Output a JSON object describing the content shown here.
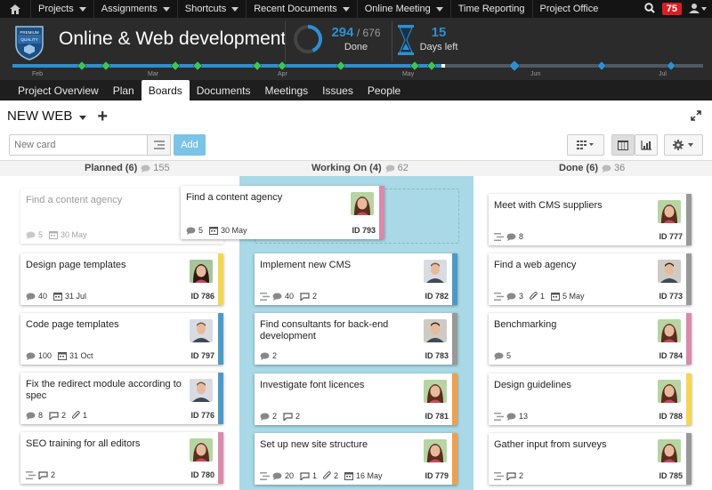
{
  "topnav": {
    "items": [
      "Projects",
      "Assignments",
      "Shortcuts",
      "Recent Documents",
      "Online Meeting",
      "Time Reporting",
      "Project Office"
    ],
    "notifications": "75"
  },
  "header": {
    "badge_text": "PREMIUM QUALITY",
    "title": "Online & Web development",
    "done_value": "294",
    "done_total": "/ 676",
    "done_label": "Done",
    "days_value": "15",
    "days_label": "Days left",
    "done_fraction": 0.435,
    "accent": "#2e8fd0"
  },
  "timeline": {
    "months": [
      "Feb",
      "Mar",
      "Apr",
      "May",
      "Jun",
      "Jul"
    ]
  },
  "tabs": [
    "Project Overview",
    "Plan",
    "Boards",
    "Documents",
    "Meetings",
    "Issues",
    "People"
  ],
  "active_tab": "Boards",
  "board": {
    "name": "NEW WEB",
    "new_card_placeholder": "New card",
    "add_label": "Add"
  },
  "columns": [
    {
      "name": "Planned (6)",
      "comments": "155"
    },
    {
      "name": "Working On (4)",
      "comments": "62"
    },
    {
      "name": "Done (6)",
      "comments": "36"
    }
  ],
  "cards": {
    "ghost": {
      "title": "Find a content agency",
      "comments": "5",
      "date": "30 May"
    },
    "dragging": {
      "title": "Find a content agency",
      "comments": "5",
      "date": "30 May",
      "id": "ID 793",
      "color": "#d98bab"
    },
    "planned": [
      {
        "title": "Design page templates",
        "comments": "40",
        "date": "31 Jul",
        "id": "ID 786",
        "color": "#f5d651"
      },
      {
        "title": "Code page templates",
        "comments": "100",
        "date": "31 Oct",
        "id": "ID 797",
        "color": "#4c99c5"
      },
      {
        "title": "Fix the redirect module according to spec",
        "comments": "8",
        "chat": "2",
        "attach": "1",
        "id": "ID 776",
        "color": "#4c99c5"
      },
      {
        "title": "SEO training for all editors",
        "chat": "2",
        "id": "ID 780",
        "color": "#d98bab"
      }
    ],
    "working": [
      {
        "title": "Implement new CMS",
        "comments": "40",
        "chat": "2",
        "id": "ID 782",
        "color": "#4c99c5"
      },
      {
        "title": "Find consultants for back-end development",
        "comments": "2",
        "id": "ID 783",
        "color": "#999999"
      },
      {
        "title": "Investigate font licences",
        "comments": "2",
        "chat": "2",
        "id": "ID 781",
        "color": "#f0a04b"
      },
      {
        "title": "Set up new site structure",
        "comments": "20",
        "chat": "1",
        "attach": "2",
        "date": "16 May",
        "id": "ID 779",
        "color": "#f0a04b"
      }
    ],
    "done": [
      {
        "title": "Meet with CMS suppliers",
        "comments": "8",
        "id": "ID 777",
        "color": "#999999"
      },
      {
        "title": "Find a web agency",
        "comments": "3",
        "attach": "1",
        "date": "5 May",
        "id": "ID 773",
        "color": "#999999"
      },
      {
        "title": "Benchmarking",
        "comments": "5",
        "id": "ID 784",
        "color": "#d98bab"
      },
      {
        "title": "Design guidelines",
        "comments": "13",
        "id": "ID 788",
        "color": "#f5d651"
      },
      {
        "title": "Gather input from surveys",
        "chat": "2",
        "id": "ID 785",
        "color": "#999999"
      }
    ]
  }
}
